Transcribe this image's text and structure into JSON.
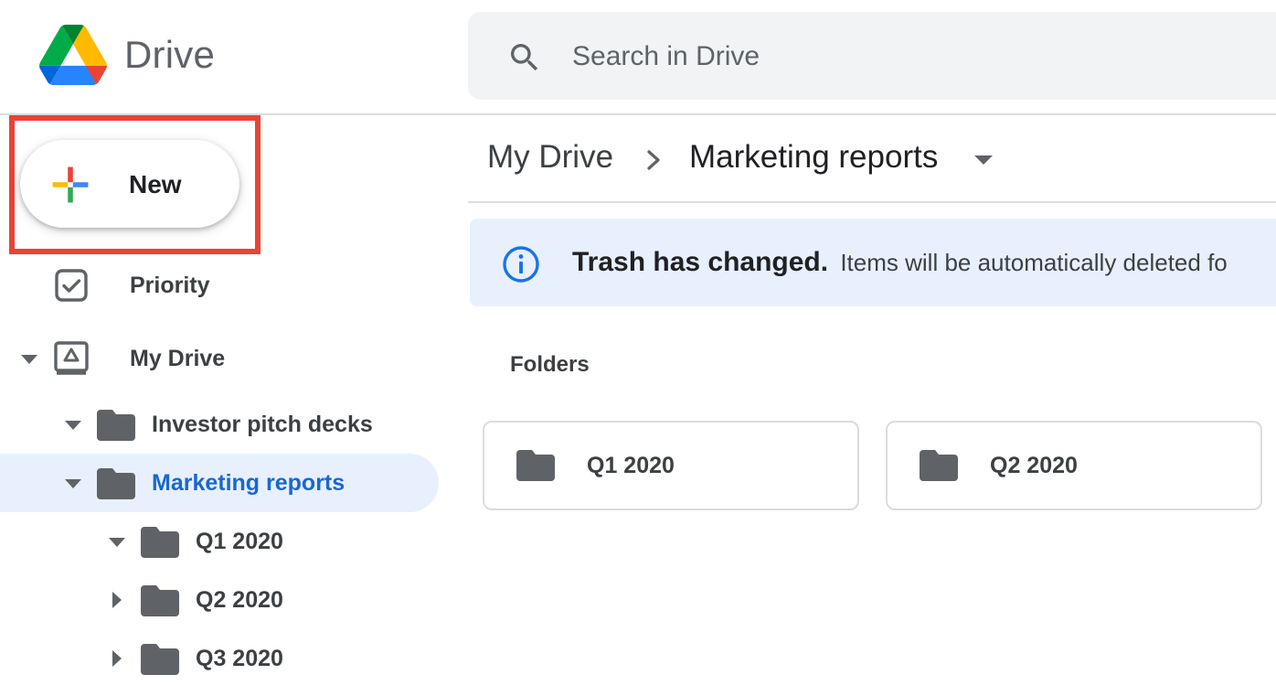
{
  "app": {
    "title": "Drive"
  },
  "search": {
    "placeholder": "Search in Drive"
  },
  "new_button": {
    "label": "New"
  },
  "sidebar": {
    "priority": {
      "label": "Priority"
    },
    "my_drive": {
      "label": "My Drive"
    },
    "tree": [
      {
        "label": "Investor pitch decks",
        "expanded": true
      },
      {
        "label": "Marketing reports",
        "expanded": true,
        "selected": true
      },
      {
        "label": "Q1 2020",
        "expanded": true
      },
      {
        "label": "Q2 2020",
        "expanded": false
      },
      {
        "label": "Q3 2020",
        "expanded": false
      }
    ]
  },
  "breadcrumb": {
    "root": "My Drive",
    "current": "Marketing reports"
  },
  "banner": {
    "title": "Trash has changed.",
    "text": "Items will be automatically deleted fo"
  },
  "main": {
    "section_title": "Folders",
    "folders": [
      {
        "label": "Q1 2020"
      },
      {
        "label": "Q2 2020"
      }
    ]
  },
  "colors": {
    "accent_blue": "#1967d2",
    "selected_bg": "#e8f0fe",
    "highlight_red": "#ea4335",
    "folder_gray": "#5f6368"
  },
  "icons": {
    "logo": "drive-logo-icon",
    "search": "search-icon",
    "new": "plus-icon",
    "priority": "priority-check-icon",
    "my_drive": "my-drive-icon",
    "folder": "folder-icon",
    "info": "info-icon"
  }
}
